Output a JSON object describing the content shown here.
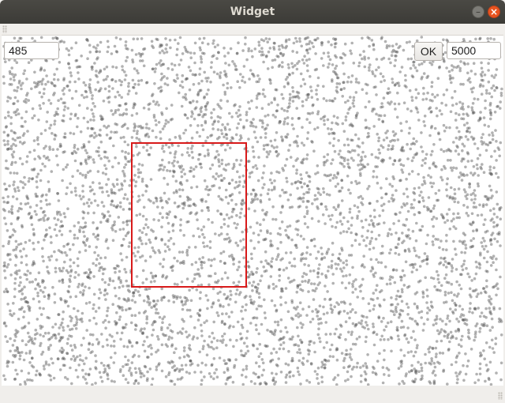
{
  "window": {
    "title": "Widget",
    "minimize_icon": "minimize-icon",
    "close_icon": "close-icon",
    "minimize_glyph": "–",
    "close_glyph": "×"
  },
  "controls": {
    "left_input_value": "485",
    "ok_label": "OK",
    "count_input_value": "5000"
  },
  "plot": {
    "point_count": 5000,
    "point_color": "#555555",
    "selection_color": "#d81a1a",
    "background": "#ffffff"
  }
}
